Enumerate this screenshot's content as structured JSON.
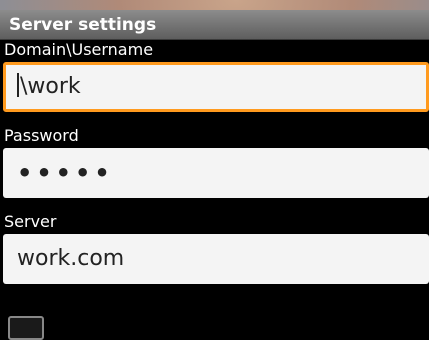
{
  "header": {
    "title": "Server settings"
  },
  "fields": {
    "username": {
      "label": "Domain\\Username",
      "value": "\\work"
    },
    "password": {
      "label": "Password",
      "value": "•••••"
    },
    "server": {
      "label": "Server",
      "value": "work.com"
    }
  },
  "colors": {
    "focus_border": "#ff9a1e",
    "input_background": "#f4f4f4",
    "screen_background": "#000000"
  }
}
